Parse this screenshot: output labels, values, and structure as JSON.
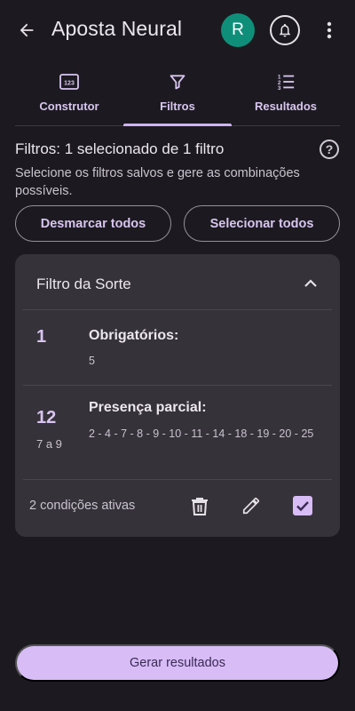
{
  "appbar": {
    "title": "Aposta Neural",
    "avatar_letter": "R",
    "icons": [
      "back-arrow-icon",
      "bell-icon",
      "more-vert-icon"
    ],
    "avatar_color": "#0f8f7a"
  },
  "tabs": [
    {
      "label": "Construtor",
      "icon": "numbers-icon",
      "active": false
    },
    {
      "label": "Filtros",
      "icon": "filter-icon",
      "active": true
    },
    {
      "label": "Resultados",
      "icon": "ordered-list-icon",
      "active": false
    }
  ],
  "filters": {
    "title": "Filtros: 1 selecionado de 1 filtro",
    "description": "Selecione os filtros salvos e gere as combinações possíveis.",
    "unselect_all": "Desmarcar todos",
    "select_all": "Selecionar todos"
  },
  "card": {
    "title": "Filtro da Sorte",
    "rows": [
      {
        "count": "1",
        "range": "",
        "label": "Obrigatórios:",
        "values": "5"
      },
      {
        "count": "12",
        "range": "7 a 9",
        "label": "Presença parcial:",
        "values": "2 - 4 - 7 - 8 - 9 - 10 - 11 - 14 - 18 - 19 - 20 - 25"
      }
    ],
    "active_conditions": "2 condições ativas",
    "checked": true
  },
  "generate_label": "Gerar resultados",
  "colors": {
    "background": "#1c1a20",
    "accent": "#d7bcf6",
    "card": "#36323a"
  }
}
